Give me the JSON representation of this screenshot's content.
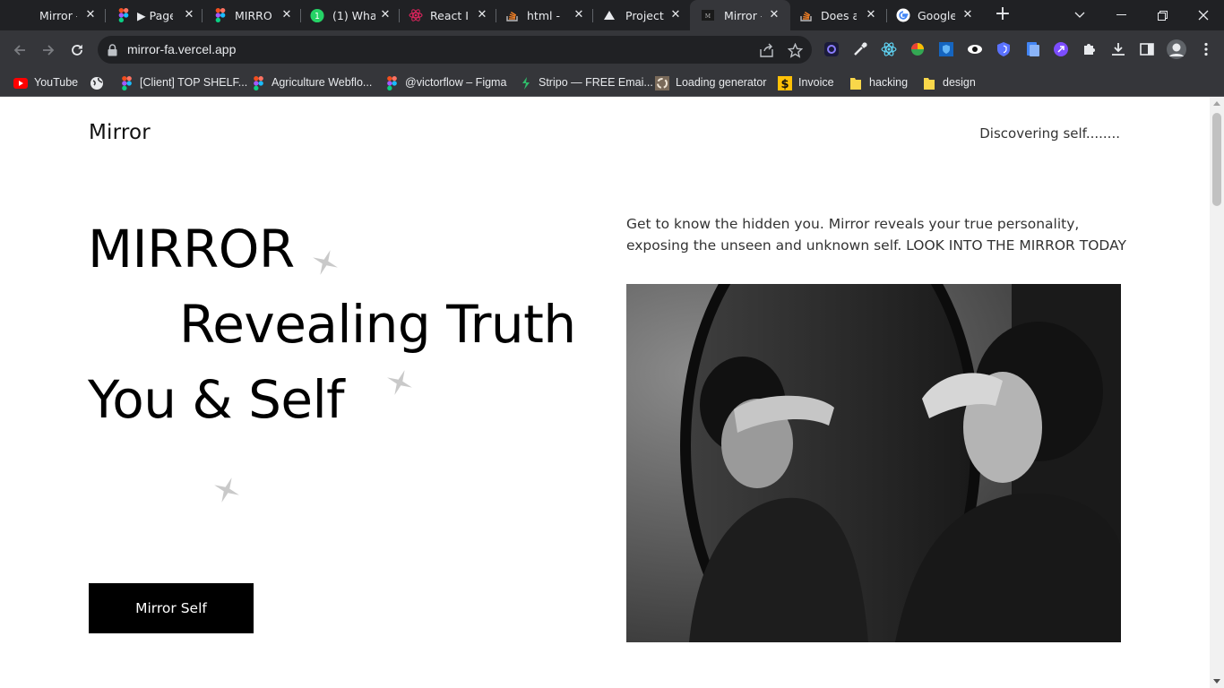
{
  "browser": {
    "tabs": [
      {
        "title": "Mirror -",
        "icon": "mirror-favicon",
        "active": false
      },
      {
        "title": "▶ Page",
        "icon": "figma-icon",
        "active": false
      },
      {
        "title": "MIRROR",
        "icon": "figma-icon",
        "active": false
      },
      {
        "title": "(1) Wha",
        "icon": "whatsapp-icon",
        "active": false
      },
      {
        "title": "React Ic",
        "icon": "react-icon",
        "active": false
      },
      {
        "title": "html - F",
        "icon": "stackoverflow-icon",
        "active": false
      },
      {
        "title": "Project",
        "icon": "vercel-icon",
        "active": false
      },
      {
        "title": "Mirror -",
        "icon": "mirror-favicon",
        "active": true
      },
      {
        "title": "Does a",
        "icon": "stackoverflow-icon",
        "active": false
      },
      {
        "title": "Google",
        "icon": "google-icon",
        "active": false
      }
    ],
    "url": "mirror-fa.vercel.app",
    "bookmarks": [
      {
        "label": "YouTube",
        "icon": "youtube-icon"
      },
      {
        "label": "",
        "icon": "globe-icon"
      },
      {
        "label": "[Client] TOP SHELF...",
        "icon": "figma-icon"
      },
      {
        "label": "Agriculture Webflo...",
        "icon": "figma-icon"
      },
      {
        "label": "@victorflow – Figma",
        "icon": "figma-icon"
      },
      {
        "label": "Stripo — FREE Emai...",
        "icon": "stripo-icon"
      },
      {
        "label": "Loading generator",
        "icon": "loading-icon"
      },
      {
        "label": "Invoice",
        "icon": "dollar-icon"
      },
      {
        "label": "hacking",
        "icon": "folder-icon"
      },
      {
        "label": "design",
        "icon": "folder-icon"
      }
    ]
  },
  "page": {
    "brand": "Mirror",
    "tagline": "Discovering self........",
    "headline": [
      "MIRROR",
      "Revealing Truth",
      "You & Self"
    ],
    "intro": "Get to know the hidden you. Mirror reveals your true personality, exposing the unseen and unknown self. LOOK INTO THE MIRROR TODAY",
    "cta_label": "Mirror Self",
    "hero_image_alt": "black-and-white photo of a woman covering her eyes in front of a round mirror"
  }
}
